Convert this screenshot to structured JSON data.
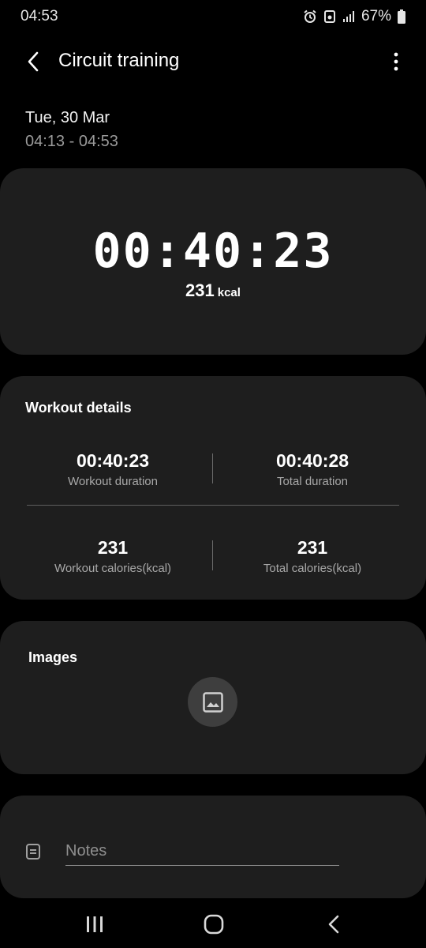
{
  "status_bar": {
    "time": "04:53",
    "battery": "67%",
    "icons": [
      "alarm-icon",
      "sync-icon",
      "signal-icon",
      "battery-icon"
    ]
  },
  "app_bar": {
    "title": "Circuit training",
    "icons": [
      "back-icon",
      "more-vert-icon"
    ]
  },
  "session": {
    "date": "Tue, 30 Mar",
    "time_range": "04:13 - 04:53"
  },
  "summary": {
    "duration": "00:40:23",
    "kcal_value": "231",
    "kcal_unit": "kcal"
  },
  "workout_details": {
    "title": "Workout details",
    "stats": [
      {
        "value": "00:40:23",
        "label": "Workout duration"
      },
      {
        "value": "00:40:28",
        "label": "Total duration"
      },
      {
        "value": "231",
        "label": "Workout calories(kcal)"
      },
      {
        "value": "231",
        "label": "Total calories(kcal)"
      }
    ]
  },
  "images": {
    "title": "Images",
    "icon": "add-image-icon"
  },
  "notes": {
    "placeholder": "Notes",
    "value": "",
    "icon": "notes-icon"
  },
  "nav_bar": {
    "icons": [
      "recents-icon",
      "home-icon",
      "back-nav-icon"
    ]
  },
  "colors": {
    "background": "#000000",
    "card": "#1e1e1e",
    "secondary_text": "#9a9a9a"
  }
}
